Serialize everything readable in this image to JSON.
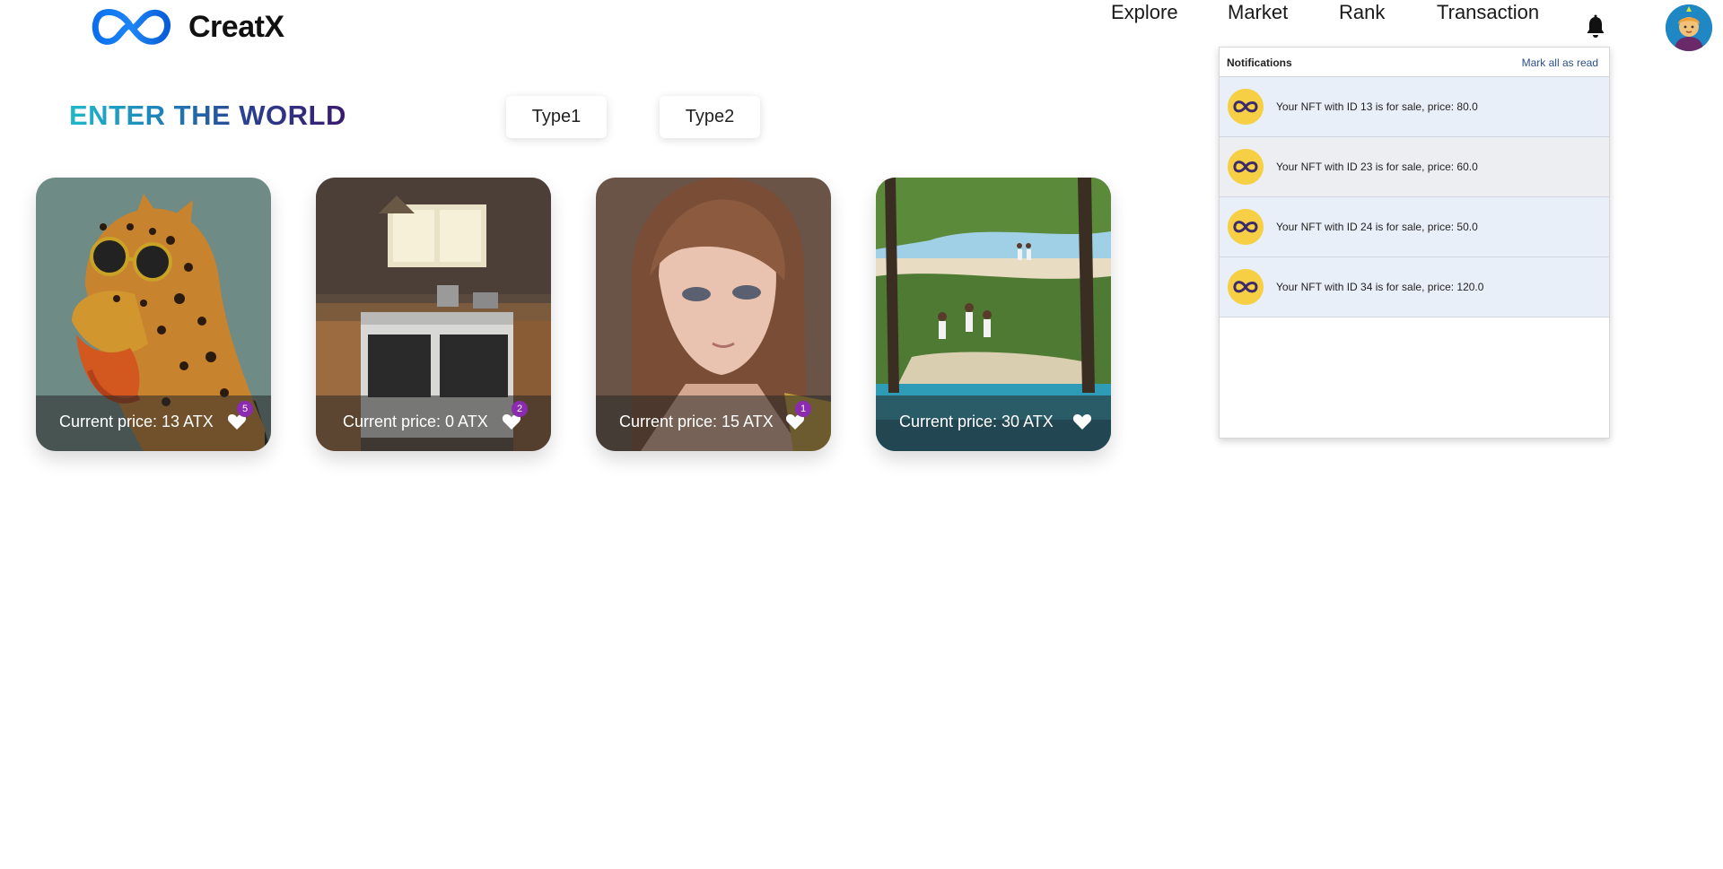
{
  "brand": {
    "name": "CreatX",
    "logo_icon": "infinity-logo-icon",
    "accent": "#1a73e8"
  },
  "nav": {
    "explore": "Explore",
    "market": "Market",
    "rank": "Rank",
    "transaction": "Transaction",
    "bell_icon": "bell-icon"
  },
  "hero": {
    "title": "ENTER THE WORLD"
  },
  "filters": {
    "type1": "Type1",
    "type2": "Type2"
  },
  "cards": [
    {
      "price": "Current price: 13 ATX",
      "likes": "5",
      "art": "leopard-character"
    },
    {
      "price": "Current price: 0 ATX",
      "likes": "2",
      "art": "kitchen-scene"
    },
    {
      "price": "Current price: 15 ATX",
      "likes": "1",
      "art": "anime-girl-portrait"
    },
    {
      "price": "Current price: 30 ATX",
      "likes": "",
      "art": "beach-children-scene"
    }
  ],
  "notifications": {
    "title": "Notifications",
    "mark_all": "Mark all as read",
    "items": [
      {
        "text": "Your NFT with ID 13 is for sale, price: 80.0"
      },
      {
        "text": "Your NFT with ID 23 is for sale, price: 60.0"
      },
      {
        "text": "Your NFT with ID 24 is for sale, price: 50.0"
      },
      {
        "text": "Your NFT with ID 34 is for sale, price: 120.0"
      }
    ]
  },
  "colors": {
    "badge": "#8a2bb0",
    "notif_unread_bg": "#e9eff8",
    "coin": "#f7cf44"
  }
}
